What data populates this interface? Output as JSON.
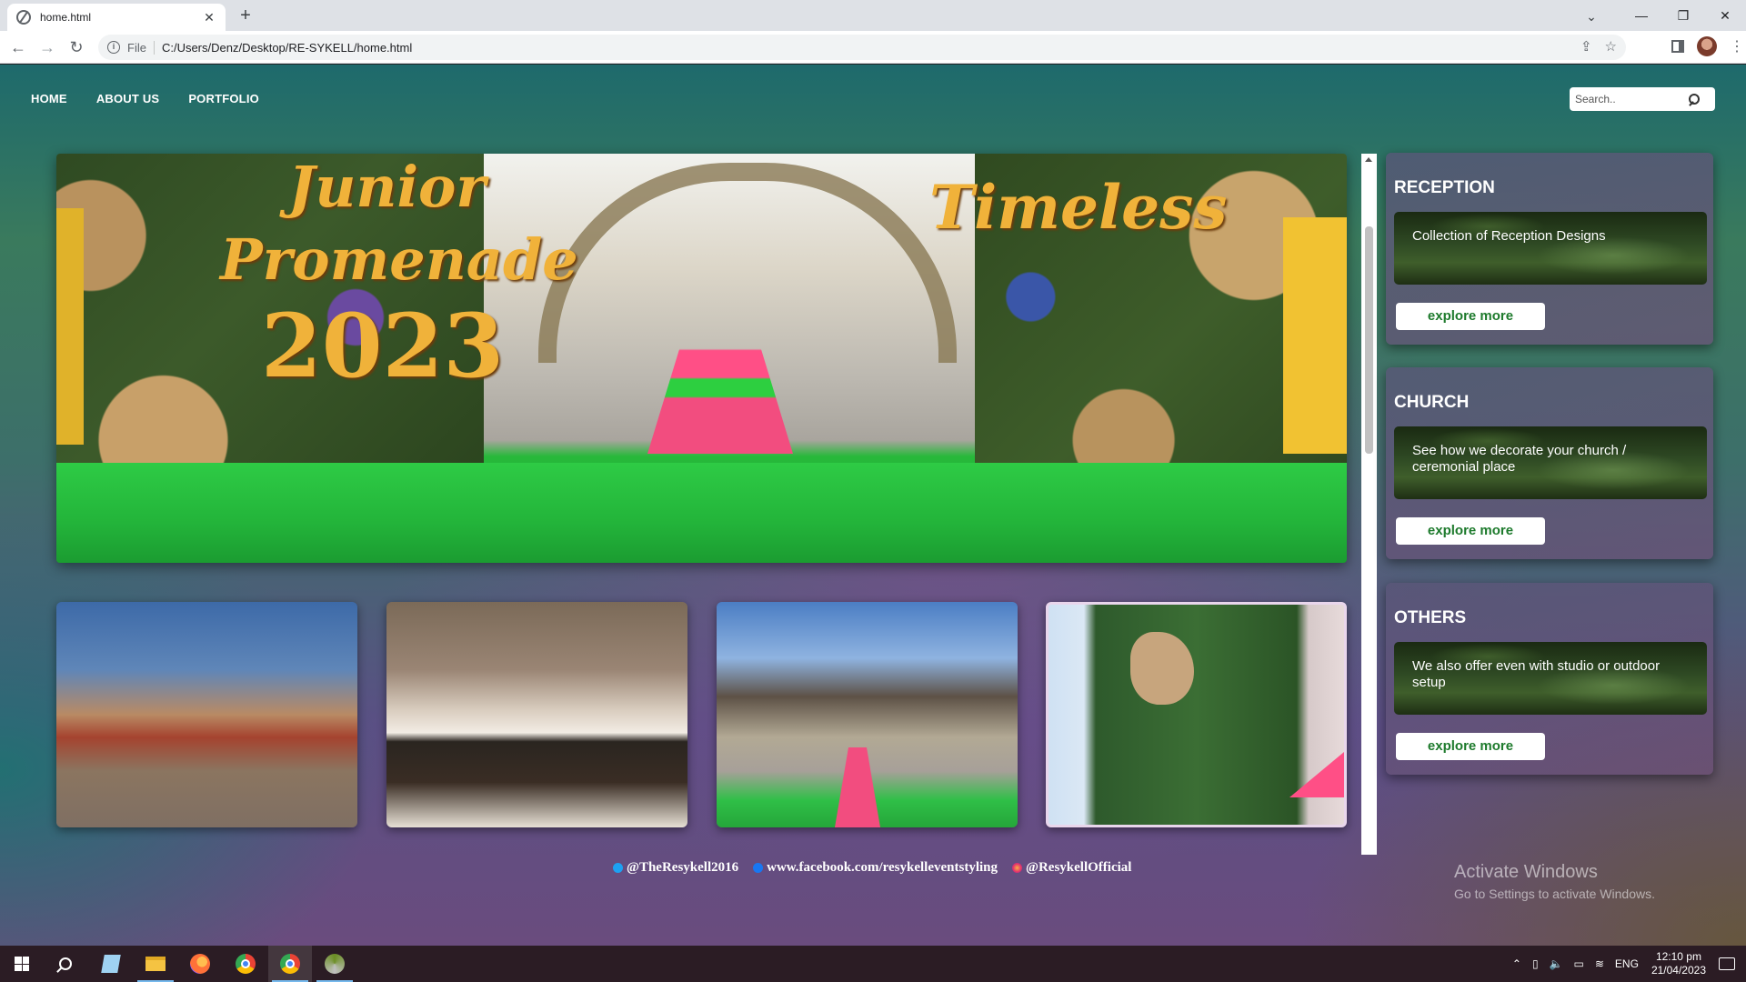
{
  "browser": {
    "tab_title": "home.html",
    "tab_close": "✕",
    "new_tab": "+",
    "scheme_label": "File",
    "url": "C:/Users/Denz/Desktop/RE-SYKELL/home.html"
  },
  "site": {
    "nav": [
      "HOME",
      "ABOUT US",
      "PORTFOLIO"
    ],
    "search_placeholder": "Search..",
    "hero_text": {
      "line1": "Junior",
      "line2": "Promenade",
      "line3": "2023",
      "right": "Timeless"
    },
    "cards": [
      {
        "title": "RECEPTION",
        "description": "Collection of Reception Designs",
        "button": "explore more"
      },
      {
        "title": "CHURCH",
        "description": "See how we decorate your church / ceremonial place",
        "button": "explore more"
      },
      {
        "title": "OTHERS",
        "description": "We also offer even with studio or outdoor setup",
        "button": "explore more"
      }
    ],
    "socials": [
      {
        "icon": "twitter-icon",
        "text": "@TheResykell2016"
      },
      {
        "icon": "facebook-icon",
        "text": "www.facebook.com/resykelleventstyling"
      },
      {
        "icon": "instagram-icon",
        "text": "@ResykellOfficial"
      }
    ]
  },
  "watermark": {
    "line1": "Activate Windows",
    "line2": "Go to Settings to activate Windows."
  },
  "taskbar": {
    "language": "ENG",
    "time": "12:10 pm",
    "date": "21/04/2023"
  },
  "colors": {
    "accent_green": "#1d7a2c",
    "hero_text_gold": "#f0b23a"
  }
}
